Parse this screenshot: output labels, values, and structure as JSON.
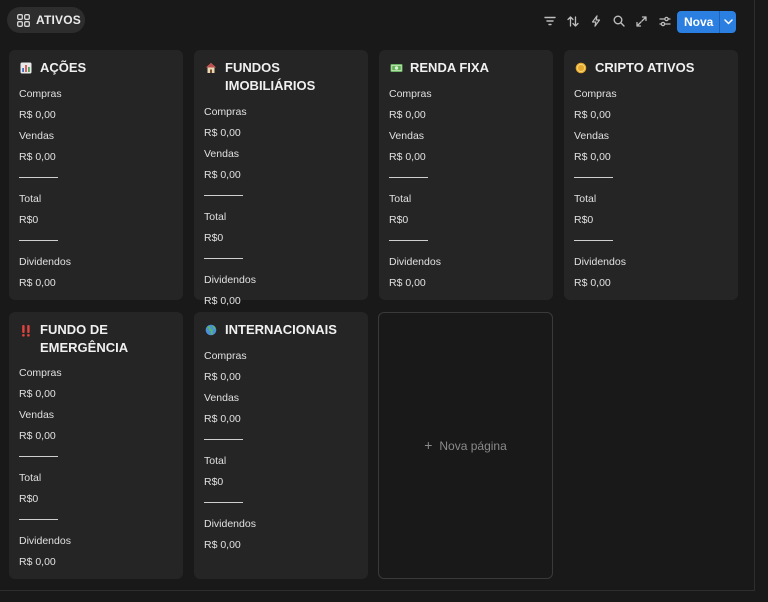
{
  "header": {
    "view_name": "ATIVOS",
    "new_button_label": "Nova"
  },
  "icons": [
    "gallery-view-icon",
    "filter-icon",
    "sort-icon",
    "automation-icon",
    "search-icon",
    "expand-icon",
    "settings-icon",
    "chevron-down-icon"
  ],
  "labels": {
    "compras": "Compras",
    "vendas": "Vendas",
    "total": "Total",
    "dividendos": "Dividendos"
  },
  "cards": [
    {
      "title": "AÇÕES",
      "icon": "bar-chart-icon",
      "compras": "R$ 0,00",
      "vendas": "R$ 0,00",
      "total": "R$0",
      "dividendos": "R$ 0,00"
    },
    {
      "title": "FUNDOS IMOBILIÁRIOS",
      "icon": "house-icon",
      "compras": "R$ 0,00",
      "vendas": "R$ 0,00",
      "total": "R$0",
      "dividendos": "R$ 0,00"
    },
    {
      "title": "RENDA FIXA",
      "icon": "money-icon",
      "compras": "R$ 0,00",
      "vendas": "R$ 0,00",
      "total": "R$0",
      "dividendos": "R$ 0,00"
    },
    {
      "title": "CRIPTO ATIVOS",
      "icon": "coin-icon",
      "compras": "R$ 0,00",
      "vendas": "R$ 0,00",
      "total": "R$0",
      "dividendos": "R$ 0,00"
    },
    {
      "title": "FUNDO DE EMERGÊNCIA",
      "icon": "double-exclamation-icon",
      "compras": "R$ 0,00",
      "vendas": "R$ 0,00",
      "total": "R$0",
      "dividendos": "R$ 0,00"
    },
    {
      "title": "INTERNACIONAIS",
      "icon": "globe-icon",
      "compras": "R$ 0,00",
      "vendas": "R$ 0,00",
      "total": "R$0",
      "dividendos": "R$ 0,00"
    }
  ],
  "new_page_label": "Nova página",
  "colors": {
    "accent": "#2a7fe0",
    "background": "#191919",
    "card": "#252525"
  }
}
